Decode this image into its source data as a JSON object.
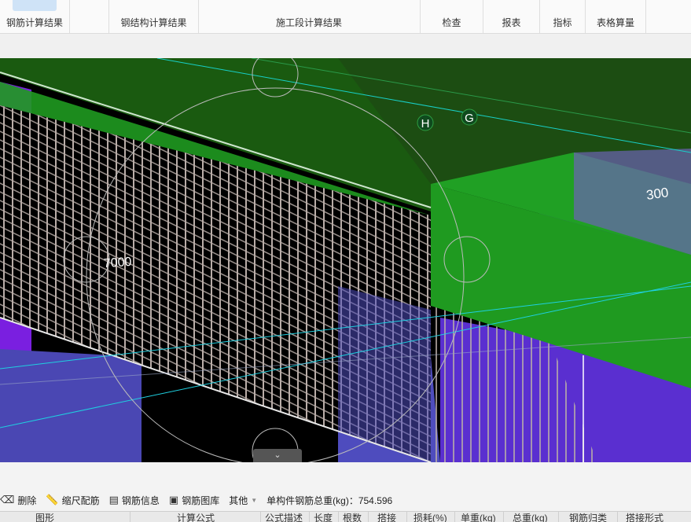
{
  "ribbon": {
    "groups": [
      {
        "label": "钢筋计算结果"
      },
      {
        "label": "钢结构计算结果"
      },
      {
        "label": "施工段计算结果"
      },
      {
        "label": "检查"
      },
      {
        "label": "报表"
      },
      {
        "label": "指标"
      },
      {
        "label": "表格算量"
      }
    ]
  },
  "viewport": {
    "axis_labels": [
      "H",
      "G"
    ],
    "dim_labels": [
      "300",
      "7000"
    ],
    "colors": {
      "beam_green": "#1f9a20",
      "slab_green": "#1c4d12",
      "column_purple": "#6a22d8",
      "blue_block": "#4a47b3",
      "rebar": "#b9ada8",
      "guide_cyan": "#1fd0e0"
    }
  },
  "bottom_toolbar": {
    "delete_label": "删除",
    "scale_rebar_label": "缩尺配筋",
    "rebar_info_label": "钢筋信息",
    "rebar_library_label": "钢筋图库",
    "other_label": "其他",
    "total_weight_text": "单构件钢筋总重(kg)：754.596"
  },
  "table": {
    "columns": [
      "图形",
      "计算公式",
      "公式描述",
      "长度",
      "根数",
      "搭接",
      "损耗(%)",
      "单重(kg)",
      "总重(kg)",
      "钢筋归类",
      "搭接形式"
    ]
  },
  "icons": [
    "delete-icon",
    "ruler-icon",
    "rebar-info-icon",
    "image-library-icon",
    "dropdown-caret-icon",
    "collapse-chevron-icon"
  ]
}
